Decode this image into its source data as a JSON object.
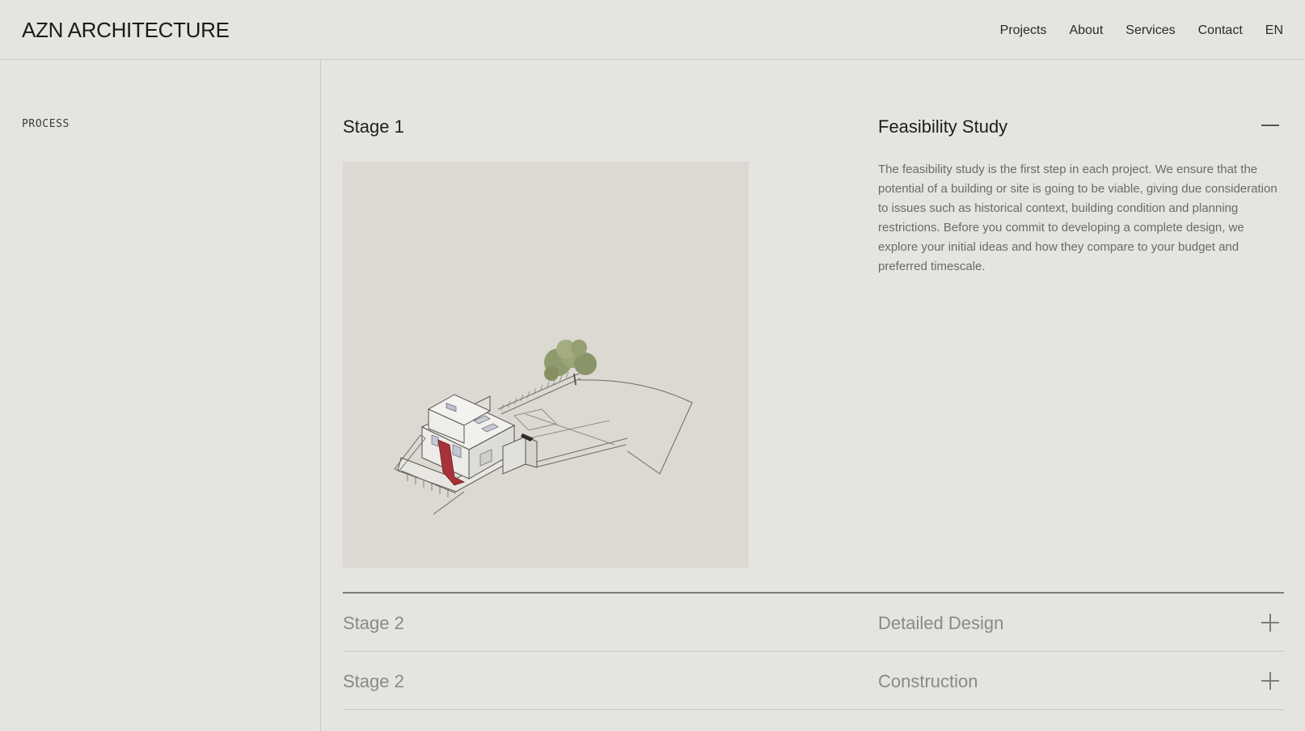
{
  "header": {
    "logo": "AZN ARCHITECTURE",
    "nav": [
      "Projects",
      "About",
      "Services",
      "Contact",
      "EN"
    ]
  },
  "sidebar": {
    "section_label": "PROCESS"
  },
  "stages": [
    {
      "number": "Stage 1",
      "title": "Feasibility Study",
      "expanded": true,
      "toggle_icon": "minus-icon",
      "description": "The feasibility study is the first step in each project.  We ensure that the potential of a building or site is going to be viable, giving due consideration to issues such as historical context, building condition and planning restrictions.  Before you commit to developing a complete design, we explore your initial ideas and how they compare to your budget and preferred timescale."
    },
    {
      "number": "Stage 2",
      "title": "Detailed Design",
      "expanded": false,
      "toggle_icon": "plus-icon"
    },
    {
      "number": "Stage 2",
      "title": "Construction",
      "expanded": false,
      "toggle_icon": "plus-icon"
    }
  ],
  "colors": {
    "background": "#e5e4e1",
    "image_background": "#dcd9d2",
    "accent_red": "#a8323a",
    "tree_green": "#8f9a6e"
  }
}
